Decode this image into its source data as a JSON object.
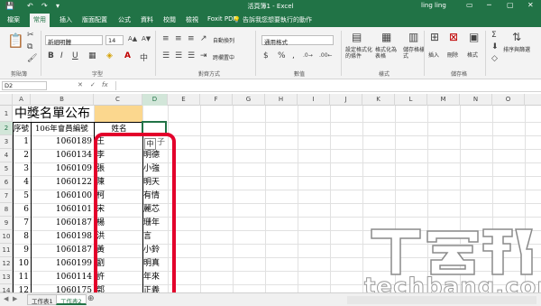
{
  "titlebar": {
    "title": "活頁簿1 - Excel",
    "user": "ling ling",
    "quick_access": [
      "💾",
      "↶",
      "↷",
      "▾"
    ],
    "window_controls": [
      "▭",
      "─",
      "▢",
      "✕"
    ]
  },
  "tabs": [
    "檔案",
    "常用",
    "插入",
    "版面配置",
    "公式",
    "資料",
    "校閱",
    "檢視",
    "Foxit PDF"
  ],
  "active_tab": "常用",
  "tellme": "告訴我您想要執行的動作",
  "ribbon": {
    "font_name": "新細明體",
    "font_size": "14",
    "number_format": "通用格式",
    "wrap_text": "自動換列",
    "merge_center": "跨欄置中",
    "conditional_format": "設定格式化的條件",
    "format_as_table": "格式化為表格",
    "cell_styles": "儲存格樣式",
    "insert": "插入",
    "delete": "刪除",
    "format": "格式",
    "sort_filter": "排序與篩選",
    "groups": [
      "剪貼簿",
      "字型",
      "對齊方式",
      "數值",
      "樣式",
      "儲存格"
    ]
  },
  "formula_bar": {
    "name_box": "D2",
    "cancel": "✕",
    "enter": "✓",
    "fx": "fx"
  },
  "columns": [
    "A",
    "B",
    "C",
    "D",
    "E",
    "F",
    "G",
    "H",
    "I",
    "J",
    "K",
    "L",
    "M",
    "N",
    "O"
  ],
  "selected_column": "D",
  "rows": [
    "1",
    "2",
    "3",
    "4",
    "5",
    "6",
    "7",
    "8",
    "9",
    "10",
    "11",
    "12",
    "13",
    "14"
  ],
  "selected_row": "2",
  "sheet": {
    "title": "中獎名單公布",
    "headers": [
      "序號",
      "106年會員編號",
      "姓名"
    ],
    "data": [
      {
        "seq": "1",
        "id": "1060189",
        "surname": "王",
        "given": ""
      },
      {
        "seq": "2",
        "id": "1060134",
        "surname": "李",
        "given": "明德"
      },
      {
        "seq": "3",
        "id": "1060109",
        "surname": "張",
        "given": "小強"
      },
      {
        "seq": "4",
        "id": "1060122",
        "surname": "陳",
        "given": "明天"
      },
      {
        "seq": "5",
        "id": "1060100",
        "surname": "柯",
        "given": "有情"
      },
      {
        "seq": "6",
        "id": "1060101",
        "surname": "宋",
        "given": "麗芯"
      },
      {
        "seq": "7",
        "id": "1060187",
        "surname": "楊",
        "given": "珊年"
      },
      {
        "seq": "8",
        "id": "1060198",
        "surname": "洪",
        "given": "言"
      },
      {
        "seq": "9",
        "id": "1060187",
        "surname": "黃",
        "given": "小鈴"
      },
      {
        "seq": "10",
        "id": "1060199",
        "surname": "劉",
        "given": "明真"
      },
      {
        "seq": "11",
        "id": "1060114",
        "surname": "許",
        "given": "年來"
      },
      {
        "seq": "12",
        "id": "1060175",
        "surname": "郭",
        "given": "正義"
      }
    ],
    "ime_char": "中",
    "partial_given_row3": "子"
  },
  "sheet_tabs": [
    "工作表1",
    "工作表2"
  ],
  "active_sheet": "工作表2",
  "add_sheet": "⊕",
  "watermark": {
    "logo_text": "T客邦",
    "text": "techbang.com"
  },
  "colors": {
    "excel_green": "#217346",
    "highlight_red": "#e3002b",
    "title_fill": "#fbd78e"
  }
}
